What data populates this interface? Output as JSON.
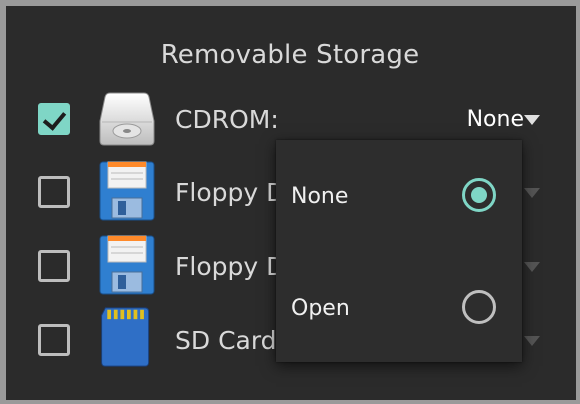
{
  "section_title": "Removable Storage",
  "devices": [
    {
      "label": "CDROM:",
      "checked": true,
      "icon": "cdrom-drive-icon",
      "value": "None"
    },
    {
      "label": "Floppy D",
      "checked": false,
      "icon": "floppy-disk-icon"
    },
    {
      "label": "Floppy D",
      "checked": false,
      "icon": "floppy-disk-icon"
    },
    {
      "label": "SD Card:",
      "checked": false,
      "icon": "sd-card-icon"
    }
  ],
  "popup": {
    "options": [
      {
        "label": "None",
        "selected": true
      },
      {
        "label": "Open",
        "selected": false
      }
    ]
  },
  "colors": {
    "accent": "#7fd6c6",
    "background": "#2b2b2b",
    "border": "#9a9a9a"
  }
}
